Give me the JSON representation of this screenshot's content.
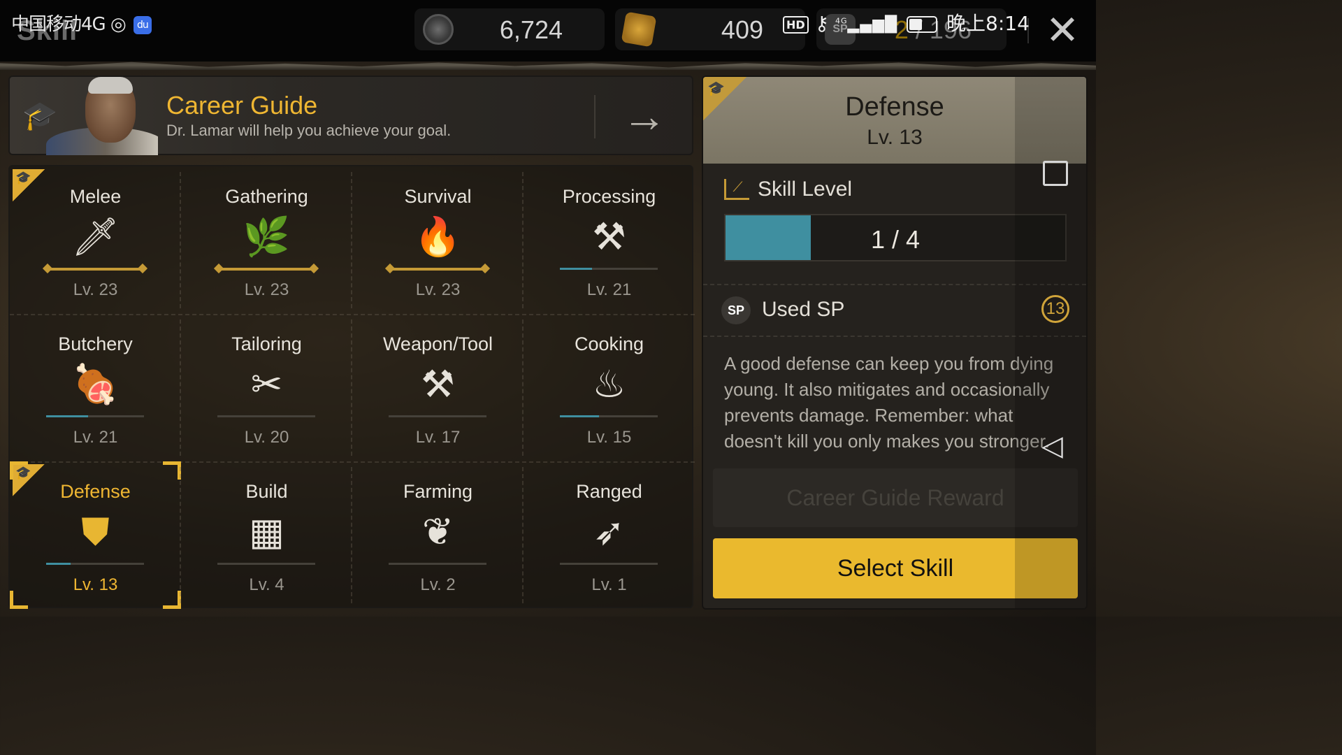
{
  "status_bar": {
    "carrier": "中国移动4G",
    "hd": "HD",
    "signal": "4G",
    "time": "晚上8:14"
  },
  "header": {
    "title": "Skill",
    "currencies": [
      {
        "icon": "clock-coin-icon",
        "value": "6,724"
      },
      {
        "icon": "gear-coin-icon",
        "value": "409"
      },
      {
        "icon": "skill-point-icon",
        "label": "SP",
        "used": "2",
        "separator": "/",
        "total": "196"
      }
    ],
    "close_symbol": "✕"
  },
  "career_guide": {
    "title": "Career Guide",
    "description": "Dr. Lamar will help you achieve your goal.",
    "arrow": "→"
  },
  "skills": [
    {
      "name": "Melee",
      "icon": "knife-icon",
      "glyph": "🗡",
      "level": "Lv. 23",
      "progress": 1.0,
      "maxed": true,
      "career": true
    },
    {
      "name": "Gathering",
      "icon": "gathering-icon",
      "glyph": "🌿",
      "level": "Lv. 23",
      "progress": 1.0,
      "maxed": true
    },
    {
      "name": "Survival",
      "icon": "campfire-icon",
      "glyph": "🔥",
      "level": "Lv. 23",
      "progress": 1.0,
      "maxed": true
    },
    {
      "name": "Processing",
      "icon": "processing-icon",
      "glyph": "⚒",
      "level": "Lv. 21",
      "progress": 0.33
    },
    {
      "name": "Butchery",
      "icon": "meat-icon",
      "glyph": "🍖",
      "level": "Lv. 21",
      "progress": 0.43
    },
    {
      "name": "Tailoring",
      "icon": "scissors-icon",
      "glyph": "✂",
      "level": "Lv. 20",
      "progress": 0.0
    },
    {
      "name": "Weapon/Tool",
      "icon": "anvil-icon",
      "glyph": "⚒",
      "level": "Lv. 17",
      "progress": 0.0
    },
    {
      "name": "Cooking",
      "icon": "cooking-pot-icon",
      "glyph": "♨",
      "level": "Lv. 15",
      "progress": 0.4
    },
    {
      "name": "Defense",
      "icon": "shield-icon",
      "glyph": "⛊",
      "level": "Lv. 13",
      "progress": 0.25,
      "selected": true,
      "career": true
    },
    {
      "name": "Build",
      "icon": "bricks-icon",
      "glyph": "▦",
      "level": "Lv. 4",
      "progress": 0.0
    },
    {
      "name": "Farming",
      "icon": "sprout-icon",
      "glyph": "❦",
      "level": "Lv. 2",
      "progress": 0.0
    },
    {
      "name": "Ranged",
      "icon": "bow-icon",
      "glyph": "➶",
      "level": "Lv. 1",
      "progress": 0.0
    }
  ],
  "detail": {
    "name": "Defense",
    "level": "Lv. 13",
    "skill_level_label": "Skill Level",
    "skill_level_value": "1 / 4",
    "skill_level_fraction": 0.25,
    "used_sp_label": "Used SP",
    "used_sp_value": "13",
    "description": "A good defense can keep you from dying young. It also mitigates and occasionally prevents damage. Remember: what doesn't kill you only makes you stronger.",
    "reward_button": "Career Guide Reward",
    "select_button": "Select Skill",
    "back_symbol": "◁"
  },
  "colors": {
    "accent_gold": "#efb632",
    "progress_teal": "#3f8fa0",
    "button_yellow": "#eab92e",
    "header_tan": "#8f8877"
  }
}
